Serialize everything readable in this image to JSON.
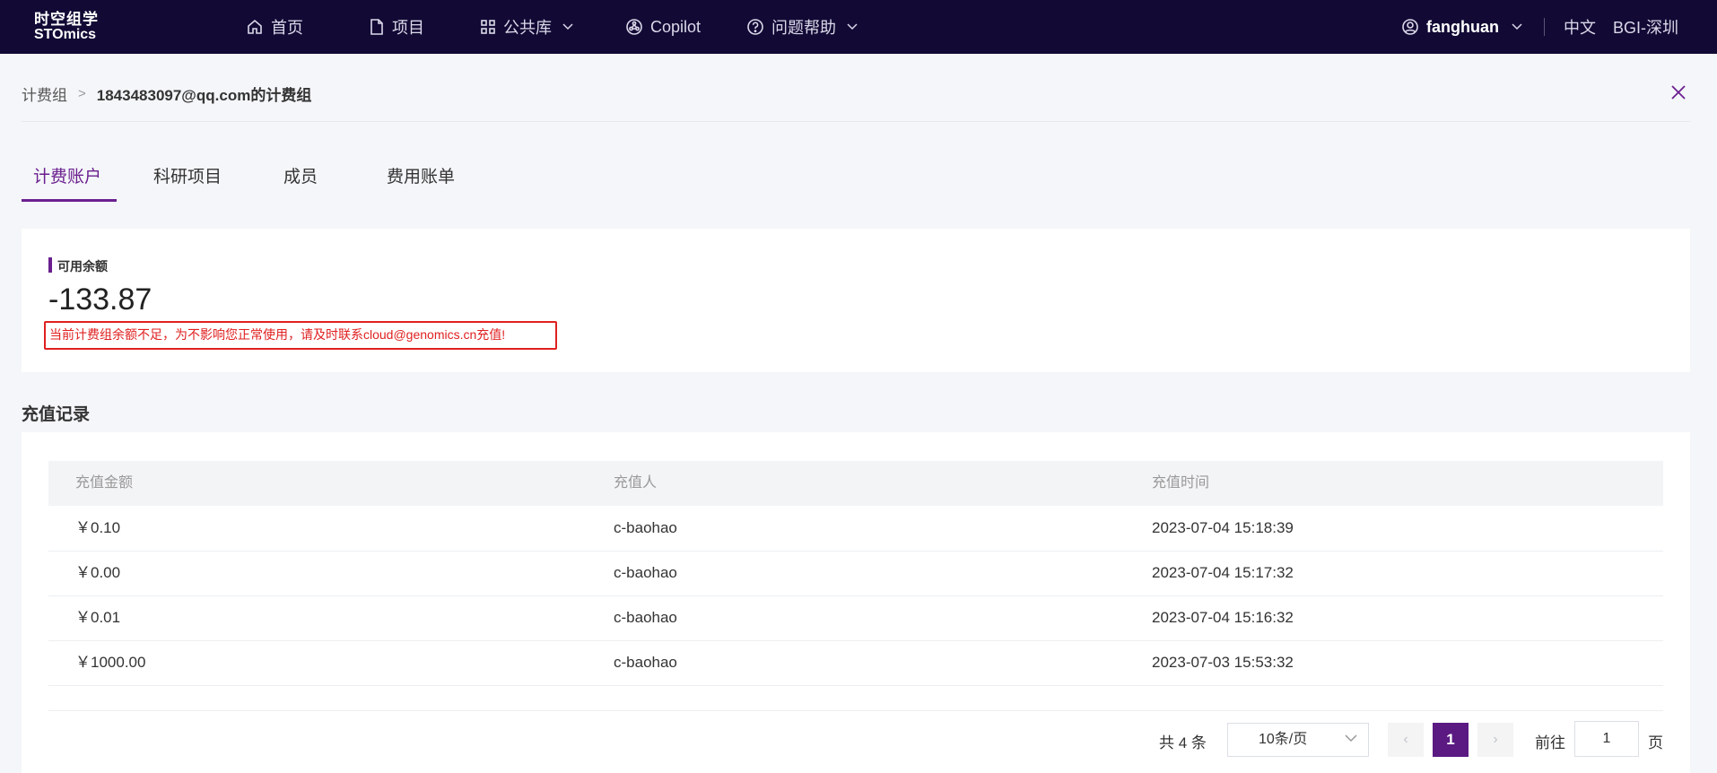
{
  "brand": {
    "line1": "时空组学",
    "line2": "STOmics"
  },
  "nav": {
    "home": "首页",
    "projects": "项目",
    "library": "公共库",
    "copilot": "Copilot",
    "help": "问题帮助"
  },
  "user": {
    "name": "fanghuan",
    "lang": "中文",
    "region": "BGI-深圳"
  },
  "breadcrumb": {
    "parent": "计费组",
    "sep": ">",
    "current": "1843483097@qq.com的计费组"
  },
  "tabs": [
    "计费账户",
    "科研项目",
    "成员",
    "费用账单"
  ],
  "balance": {
    "label": "可用余额",
    "amount": "-133.87",
    "warning": "当前计费组余额不足，为不影响您正常使用，请及时联系cloud@genomics.cn充值!"
  },
  "records": {
    "title": "充值记录",
    "columns": [
      "充值金额",
      "充值人",
      "充值时间"
    ],
    "rows": [
      {
        "amount": "￥0.10",
        "person": "c-baohao",
        "time": "2023-07-04 15:18:39"
      },
      {
        "amount": "￥0.00",
        "person": "c-baohao",
        "time": "2023-07-04 15:17:32"
      },
      {
        "amount": "￥0.01",
        "person": "c-baohao",
        "time": "2023-07-04 15:16:32"
      },
      {
        "amount": "￥1000.00",
        "person": "c-baohao",
        "time": "2023-07-03 15:53:32"
      }
    ]
  },
  "pagination": {
    "total": "共 4 条",
    "page_size": "10条/页",
    "prev": "‹",
    "current": "1",
    "next": "›",
    "goto_label": "前往",
    "goto_value": "1",
    "goto_unit": "页"
  },
  "colors": {
    "nav_bg": "#120a35",
    "accent": "#6b1f8f",
    "warning": "#e02020",
    "pager_active": "#5a1a82"
  }
}
